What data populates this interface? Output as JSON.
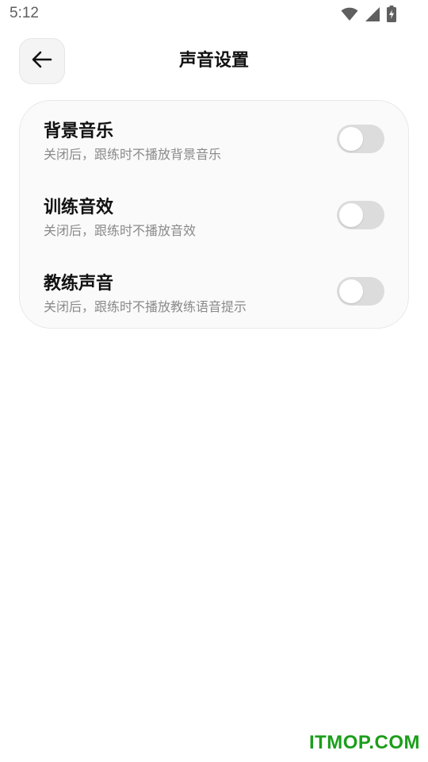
{
  "status_bar": {
    "time": "5:12",
    "icons": [
      "wifi-icon",
      "cellular-signal-icon",
      "battery-charging-icon"
    ]
  },
  "header": {
    "back_icon": "arrow-left-icon",
    "title": "声音设置"
  },
  "settings": [
    {
      "title": "背景音乐",
      "description": "关闭后，跟练时不播放背景音乐",
      "enabled": false
    },
    {
      "title": "训练音效",
      "description": "关闭后，跟练时不播放音效",
      "enabled": false
    },
    {
      "title": "教练声音",
      "description": "关闭后，跟练时不播放教练语音提示",
      "enabled": false
    }
  ],
  "watermark": "ITMOP.COM",
  "colors": {
    "background": "#ffffff",
    "card_background": "#fafafa",
    "toggle_off": "#dcdcdc",
    "watermark": "#1b9e1b"
  }
}
